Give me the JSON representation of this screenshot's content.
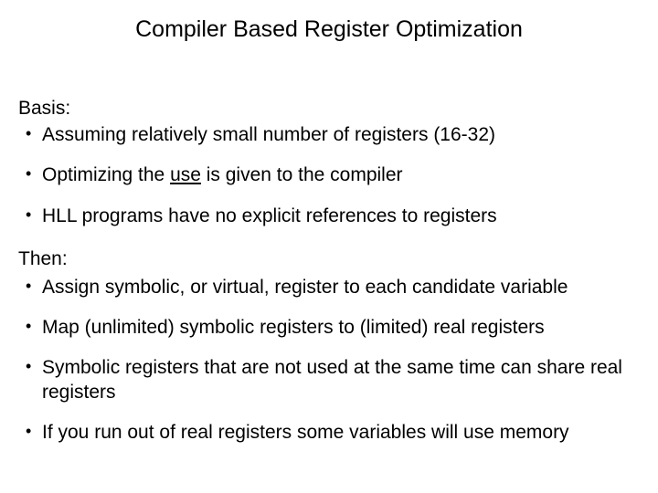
{
  "title": "Compiler Based Register Optimization",
  "basis": {
    "label": "Basis:",
    "items": [
      "Assuming relatively small number of registers (16-32)",
      "Optimizing the __USE__ is given to the compiler",
      "HLL programs have no explicit references to registers"
    ]
  },
  "then": {
    "label": "Then:",
    "items": [
      "Assign symbolic, or virtual, register to each candidate variable",
      "Map (unlimited) symbolic registers to (limited) real registers",
      "Symbolic registers that are not used at the same time can share real registers",
      "If you run out of real registers some variables will use memory"
    ]
  }
}
